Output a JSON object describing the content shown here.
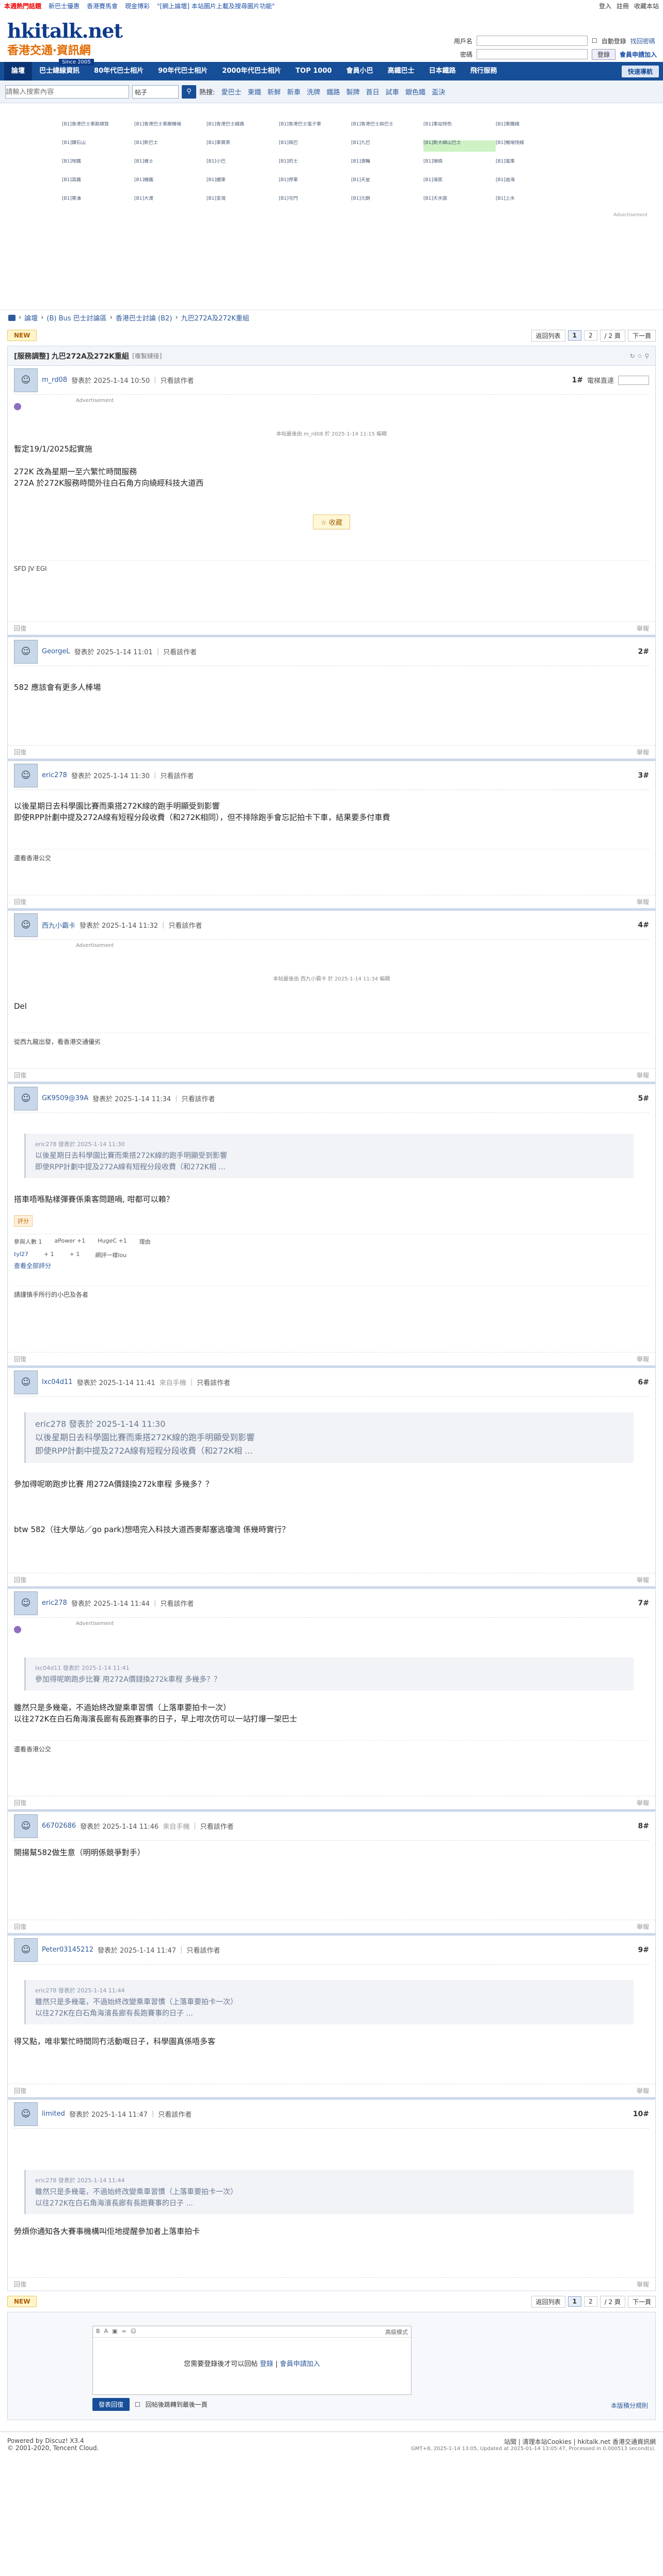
{
  "topbar": {
    "hot": "本週熱門話題",
    "l1": "新巴士優惠",
    "l2": "香港賽馬會",
    "l3": "現金博彩",
    "links": "\"[網上論壇] 本站圖片上載及搜尋圖片功能\"",
    "right": [
      "登入",
      "註冊",
      "收藏本站"
    ]
  },
  "header": {
    "logo1": "hkitalk.net",
    "logo2": "香港交通‧資訊網",
    "logo3": "Since 2005",
    "user_label": "用戶名",
    "pass_label": "密碼",
    "auto_login": "自動登錄",
    "forgot": "找回密碼",
    "login_btn": "登錄",
    "register": "會員申請加入"
  },
  "nav": [
    "論壇",
    "巴士總線資訊",
    "80年代巴士相片",
    "90年代巴士相片",
    "2000年代巴士相片",
    "TOP 1000",
    "會員小巴",
    "高鐵巴士",
    "日本鐵路",
    "飛行服務"
  ],
  "nav_quick": "快速導航",
  "search": {
    "placeholder": "請輸入搜索內容",
    "type": "帖子",
    "hot": [
      "熱搜:",
      "愛巴士",
      "東鐵",
      "新鮮",
      "新車",
      "洗牌",
      "鐵路",
      "製牌",
      "首日",
      "試車",
      "銀色鐵",
      "盃決"
    ]
  },
  "ads": [
    "[B1]香港巴士車款總覽",
    "[B1]香港巴士車廠機場",
    "[B1]香港巴士線路",
    "[B1]香港巴士電子車",
    "[B1]香港巴士與巴士",
    "[B1]車站特色",
    "[B1]東鐵綫",
    "[B1]鑽石山",
    "[B1]新巴士",
    "[B1]車費表",
    "[B1]城巴",
    "[B1]九巴",
    "[B1]新大嶼山巴士",
    "[B1]機場快線",
    "[B1]地鐵",
    "[B1]雅士",
    "[B1]小巴",
    "[B1]的士",
    "[B1]渡輪",
    "[B1]環繞",
    "[B1]電車",
    "[B1]高鐵",
    "[B1]機鐵",
    "[B1]纜車",
    "[B1]停車",
    "[B1]天星",
    "[B1]海底",
    "[B1]過海",
    "[B1]東涌",
    "[B1]大澳",
    "[B1]荃灣",
    "[B1]屯門",
    "[B1]元朗",
    "[B1]天水圍",
    "[B1]上水"
  ],
  "ad_label": "Advertisement",
  "crumb": [
    "論壇",
    "(B) Bus 巴士討論區",
    "香港巴士討論 (B2)",
    "九巴272A及272K重組"
  ],
  "pager": {
    "new": "NEW",
    "back": "返回列表",
    "p1": "1",
    "p2": "2",
    "pgtotal": "/ 2 頁",
    "next": "下一頁"
  },
  "thread": {
    "tag": "[服務調整]",
    "title": "九巴272A及272K重組",
    "sub": "[複製鏈接]",
    "tools": "↻ ☆ ⚲"
  },
  "posts": [
    {
      "user": "m_rd08",
      "time": "發表於 2025-1-14 10:50",
      "only": "只看該作者",
      "floor": "1#",
      "extra": "電梯直達",
      "body1": "暫定19/1/2025起實施",
      "body2": "272K 改為星期一至六繁忙時間服務",
      "body3": "272A 於272K服務時間外往白石角方向繞經科技大道西",
      "edit": "本帖最後由 m_rd08 於 2025-1-14 11:15 編輯",
      "fav": "收藏",
      "sig": "SFD JV EGI",
      "reply": "回復",
      "report": "舉報"
    },
    {
      "user": "GeorgeL",
      "time": "發表於 2025-1-14 11:01",
      "only": "只看該作者",
      "floor": "2#",
      "body1": "582 應該會有更多人棒場",
      "reply": "回復",
      "report": "舉報"
    },
    {
      "user": "eric278",
      "time": "發表於 2025-1-14 11:30",
      "only": "只看該作者",
      "floor": "3#",
      "body1": "以後星期日去科學園比賽而乘搭272K線的跑手明顯受到影響",
      "body2": "即使RPP計劃中提及272A線有短程分段收費（和272K相同），但不排除跑手會忘記拍卡下車，結果要多付車費",
      "sig": "還看香港公交",
      "reply": "回復",
      "report": "舉報"
    },
    {
      "user": "西九小霸卡",
      "time": "發表於 2025-1-14 11:32",
      "only": "只看該作者",
      "floor": "4#",
      "edit": "本帖最後由 西九小霸卡 於 2025-1-14 11:34 編輯",
      "body1": "Del",
      "sig": "從西九龍出發，看香港交通優劣",
      "reply": "回復",
      "report": "舉報"
    },
    {
      "user": "GK9509@39A",
      "time": "發表於 2025-1-14 11:34",
      "only": "只看該作者",
      "floor": "5#",
      "qn": "eric278 發表於 2025-1-14 11:30",
      "q1": "以後星期日去科學園比賽而乘搭272K線的跑手明顯受到影響",
      "q2": "即使RPP計劃中提及272A線有短程分段收費（和272K相 ...",
      "body1": "搭車唔喺點樣彈賽係乘客問題喎, 咁都可以賴？",
      "rating": "評分",
      "r_h1": "參與人數 1",
      "r_h2": "aPower +1",
      "r_h3": "HugeC +1",
      "r_h4": "理由",
      "r_user": "tyl27",
      "r_v1": "+ 1",
      "r_v2": "+ 1",
      "r_reason": "網評一樣lou",
      "r_log": "查看全部評分",
      "sig": "請謹慎手所行的小巴及各者",
      "reply": "回復",
      "report": "舉報"
    },
    {
      "user": "lxc04d11",
      "time": "發表於 2025-1-14 11:41",
      "src": "來自手機",
      "only": "只看該作者",
      "floor": "6#",
      "qn": "eric278 發表於 2025-1-14 11:30",
      "q1": "以後星期日去科學園比賽而乘搭272K線的跑手明顯受到影響",
      "q2": "即使RPP計劃中提及272A線有短程分段收費（和272K相 ...",
      "body1": "參加得呢啲跑步比賽 用272A價錢換272k車程 多幾多？？",
      "body2": "btw 582（往大學站／go park)想唔完入科技大道西麥鄰塞逃瓊灣 係幾時實行？",
      "reply": "回復",
      "report": "舉報"
    },
    {
      "user": "eric278",
      "time": "發表於 2025-1-14 11:44",
      "only": "只看該作者",
      "floor": "7#",
      "qn": "lxc04d11 發表於 2025-1-14 11:41",
      "q1": "參加得呢啲跑步比賽 用272A價錢換272k車程 多幾多？？",
      "body1": "雖然只是多幾毫，不過始終改變乘車習慣（上落車要拍卡一次）",
      "body2": "以往272K在白石角海濱長廊有長跑賽事的日子，早上咁次仿可以一站打爆一架巴士",
      "sig": "還看香港公交",
      "reply": "回復",
      "report": "舉報"
    },
    {
      "user": "66702686",
      "time": "發表於 2025-1-14 11:46",
      "src": "來自手機",
      "only": "只看該作者",
      "floor": "8#",
      "body1": "開揚幫582做生意（明明係競爭對手）",
      "reply": "回復",
      "report": "舉報"
    },
    {
      "user": "Peter03145212",
      "time": "發表於 2025-1-14 11:47",
      "only": "只看該作者",
      "floor": "9#",
      "qn": "eric278 發表於 2025-1-14 11:44",
      "q1": "雖然只是多幾毫，不過始終改變乘車習慣（上落車要拍卡一次）",
      "q2": "以往272K在白石角海濱長廊有長跑賽事的日子 ...",
      "body1": "得又點，唯非繁忙時間同冇活動嘅日子，科學園真係唔多客",
      "reply": "回復",
      "report": "舉報"
    },
    {
      "user": "limited",
      "time": "發表於 2025-1-14 11:47",
      "only": "只看該作者",
      "floor": "10#",
      "qn": "eric278 發表於 2025-1-14 11:44",
      "q1": "雖然只是多幾毫，不過始終改變乘車習慣（上落車要拍卡一次）",
      "q2": "以往272K在白石角海濱長廊有長跑賽事的日子 ...",
      "body1": "勞煩你通知各大賽事機構叫佢地提醒參加者上落車拍卡",
      "reply": "回復",
      "report": "舉報"
    }
  ],
  "replybox": {
    "mode": "高級模式",
    "msg": "您需要登錄後才可以回帖",
    "login": "登錄",
    "sep": " | ",
    "reg": "會員申請加入",
    "submit": "發表回復",
    "check": "回帖後跳轉到最後一頁",
    "score": "本版積分規則"
  },
  "footer": {
    "powered": "Powered by Discuz! X3.4",
    "copy": "© 2001-2020, Tencent Cloud.",
    "right1": "站聞 | 清理本站Cookies | hkitalk.net 香港交通資訊網",
    "right2": "GMT+8, 2025-1-14 13:05, Updated at 2025-01-14 13:05:47, Processed in 0.000513 second(s)."
  }
}
